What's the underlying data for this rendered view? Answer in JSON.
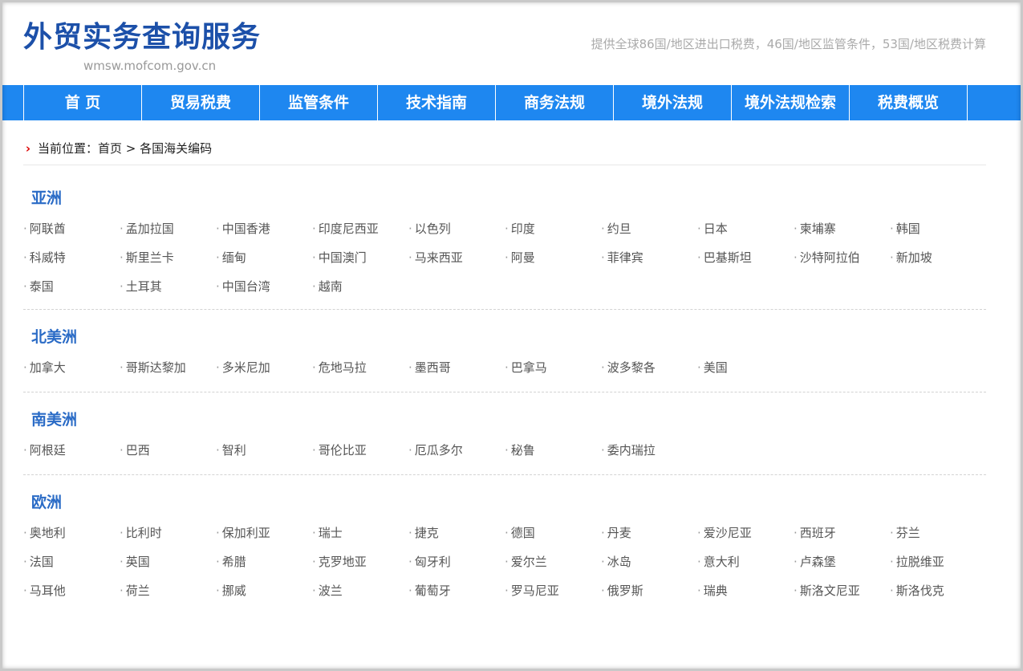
{
  "header": {
    "title": "外贸实务查询服务",
    "domain": "wmsw.mofcom.gov.cn",
    "tagline": "提供全球86国/地区进出口税费，46国/地区监管条件，53国/地区税费计算"
  },
  "nav": [
    {
      "label": "首 页"
    },
    {
      "label": "贸易税费"
    },
    {
      "label": "监管条件"
    },
    {
      "label": "技术指南"
    },
    {
      "label": "商务法规"
    },
    {
      "label": "境外法规"
    },
    {
      "label": "境外法规检索"
    },
    {
      "label": "税费概览"
    }
  ],
  "breadcrumb": {
    "prefix": "当前位置：",
    "home": "首页",
    "separator": " > ",
    "current": "各国海关编码"
  },
  "regions": [
    {
      "name": "亚洲",
      "countries": [
        "阿联酋",
        "孟加拉国",
        "中国香港",
        "印度尼西亚",
        "以色列",
        "印度",
        "约旦",
        "日本",
        "柬埔寨",
        "韩国",
        "科威特",
        "斯里兰卡",
        "缅甸",
        "中国澳门",
        "马来西亚",
        "阿曼",
        "菲律宾",
        "巴基斯坦",
        "沙特阿拉伯",
        "新加坡",
        "泰国",
        "土耳其",
        "中国台湾",
        "越南"
      ]
    },
    {
      "name": "北美洲",
      "countries": [
        "加拿大",
        "哥斯达黎加",
        "多米尼加",
        "危地马拉",
        "墨西哥",
        "巴拿马",
        "波多黎各",
        "美国"
      ]
    },
    {
      "name": "南美洲",
      "countries": [
        "阿根廷",
        "巴西",
        "智利",
        "哥伦比亚",
        "厄瓜多尔",
        "秘鲁",
        "委内瑞拉"
      ]
    },
    {
      "name": "欧洲",
      "countries": [
        "奥地利",
        "比利时",
        "保加利亚",
        "瑞士",
        "捷克",
        "德国",
        "丹麦",
        "爱沙尼亚",
        "西班牙",
        "芬兰",
        "法国",
        "英国",
        "希腊",
        "克罗地亚",
        "匈牙利",
        "爱尔兰",
        "冰岛",
        "意大利",
        "卢森堡",
        "拉脱维亚",
        "马耳他",
        "荷兰",
        "挪威",
        "波兰",
        "葡萄牙",
        "罗马尼亚",
        "俄罗斯",
        "瑞典",
        "斯洛文尼亚",
        "斯洛伐克"
      ]
    }
  ],
  "colors": {
    "title": "#1c50a9",
    "nav_bg": "#1e87f0",
    "region_title": "#2a6bc6",
    "breadcrumb_arrow": "#dd0000"
  }
}
